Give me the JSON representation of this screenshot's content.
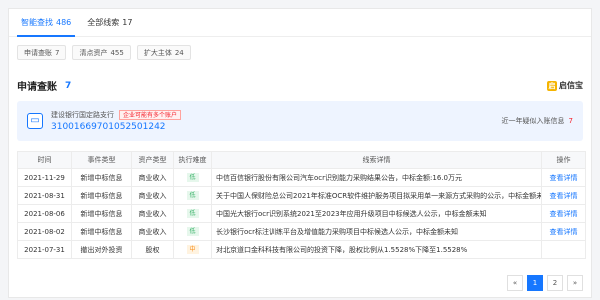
{
  "tabs": [
    {
      "label": "智能查找",
      "count": "486"
    },
    {
      "label": "全部线索",
      "count": "17"
    }
  ],
  "subtabs": [
    {
      "label": "申请查账",
      "count": "7"
    },
    {
      "label": "清点资产",
      "count": "455"
    },
    {
      "label": "扩大主体",
      "count": "24"
    }
  ],
  "section": {
    "title": "申请查账",
    "count": "7",
    "brand": "启信宝",
    "brand_icon": "qixinbao-logo-icon"
  },
  "bank": {
    "name": "建设银行国定路支行",
    "warning": "企业可能有多个账户",
    "account": "31001669701052501242",
    "right_label": "近一年疑似入账信息",
    "right_count": "7"
  },
  "table": {
    "headers": [
      "时间",
      "事件类型",
      "资产类型",
      "执行难度",
      "线索详情",
      "操作"
    ],
    "rows": [
      {
        "time": "2021-11-29",
        "event": "新增中标信息",
        "asset": "商业收入",
        "difficulty": "低",
        "level": "low",
        "detail": "中信百信银行股份有限公司汽车ocr识别能力采购结果公告，中标金额:16.0万元",
        "action": "查看详情"
      },
      {
        "time": "2021-08-31",
        "event": "新增中标信息",
        "asset": "商业收入",
        "difficulty": "低",
        "level": "low",
        "detail": "关于中国人保财险总公司2021年标准OCR软件维护服务项目拟采用单一来源方式采购的公示，中标金额未知",
        "action": "查看详情"
      },
      {
        "time": "2021-08-06",
        "event": "新增中标信息",
        "asset": "商业收入",
        "difficulty": "低",
        "level": "low",
        "detail": "中国光大银行ocr识别系统2021至2023年应用升级项目中标候选人公示，中标金额未知",
        "action": "查看详情"
      },
      {
        "time": "2021-08-02",
        "event": "新增中标信息",
        "asset": "商业收入",
        "difficulty": "低",
        "level": "low",
        "detail": "长沙银行ocr标注训练平台及增值能力采购项目中标候选人公示，中标金额未知",
        "action": "查看详情"
      },
      {
        "time": "2021-07-31",
        "event": "撤出对外投资",
        "asset": "股权",
        "difficulty": "中",
        "level": "mid",
        "detail": "对北京道口金科科技有限公司的投资下降，股权比例从1.5528%下降至1.5528%",
        "action": ""
      }
    ]
  },
  "pagination": {
    "prev": "«",
    "pages": [
      "1",
      "2"
    ],
    "next": "»",
    "current": "1"
  },
  "colors": {
    "accent": "#1677ff",
    "danger": "#f5222d",
    "low": "#3bb36a",
    "mid": "#fa8c16"
  }
}
